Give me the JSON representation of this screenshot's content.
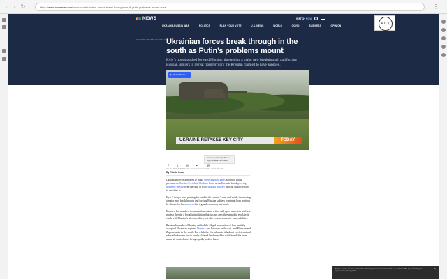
{
  "browser": {
    "back": "‹",
    "forward": "›",
    "reload": "↻",
    "url_host": "www.nbcnews.com",
    "url_path": "/news/world/ukraine-forces-break-through-south-putin-problems-mount-rcna-...",
    "url_scheme": "https://",
    "menu": "⋮"
  },
  "nav": {
    "logo": "NEWS",
    "links": [
      "UKRAINE-RUSSIA WAR",
      "POLITICS",
      "PLAN YOUR VOTE",
      "U.S. NEWS",
      "WORLD",
      "COVID",
      "BUSINESS",
      "OPINION"
    ],
    "watch": "WATCH",
    "watch_now": "NOW"
  },
  "badge": {
    "text": "KUT"
  },
  "article": {
    "eyebrow": "UKRAINE-RUSSIA CONFLICT",
    "headline": "Ukrainian forces break through in the south as Putin’s problems mount",
    "dek": "Kyiv’s troops pushed forward Monday, threatening a major new breakthrough and forcing Russian soldiers to retreat from territory the Kremlin claimed to have annexed.",
    "video": {
      "chip": "▶ 04:28 VIDEO",
      "lower_third": "UKRAINE RETAKES KEY CITY",
      "today": "TODAY"
    },
    "save_text": "Create your free profile or log in to save this article",
    "meta": "Oct. 3, 2022, 6:40 PM UTC / Updated Oct. 3, 2022, 10:10 PM UTC",
    "byline": "By Rhoda Kwan",
    "paragraphs": [
      {
        "pre": "Ukrainian forces appeared to make ",
        "link1": "sweeping new gains",
        "mid1": " Monday, piling pressure on ",
        "link2": "Russian President Vladimir Putin",
        "mid2": " at the Kremlin faced ",
        "link3": "growing domestic unease",
        "mid3": " over the state of its ",
        "link4": "struggling military",
        "post": " and the chaotic efforts to mobilize it."
      },
      {
        "pre": "Kyiv’s troops were pushing forward in the country’s east and south, threatening a major new breakthrough and forcing Russian soldiers to retreat from territory he claimed to have ",
        "link1": "annexed",
        "post": " in a grand ceremony last week."
      },
      {
        "text": "Moscow has matched its annexation claims with a call-up of reservists and new nuclear threats, a broad intimidation that has not only threatened to escalate its clash with Ukraine’s Western allies, but also expose domestic vulnerabilities."
      },
      {
        "pre": "Russian lawmakers Monday ratified the illegal annexation of four partially occupied Ukrainian regions: ",
        "link1": "Donetsk",
        "post": " and Luhansk in the east, and Kherson and Zaporizhzhia in the south. But while the Kremlin said it had not yet determined where the borders for its newly claimed land would be established, the areas under its control were being rapidly pushed back."
      }
    ]
  },
  "toast": {
    "text": "Notice: we use cookies and similar technologies to personalize content and analyze traffic. By continuing you agree to our privacy policy.",
    "close": "×"
  },
  "colors": {
    "hero_bg": "#1d2a46",
    "link": "#2d5cff",
    "today_orange": "#f6a21a"
  }
}
